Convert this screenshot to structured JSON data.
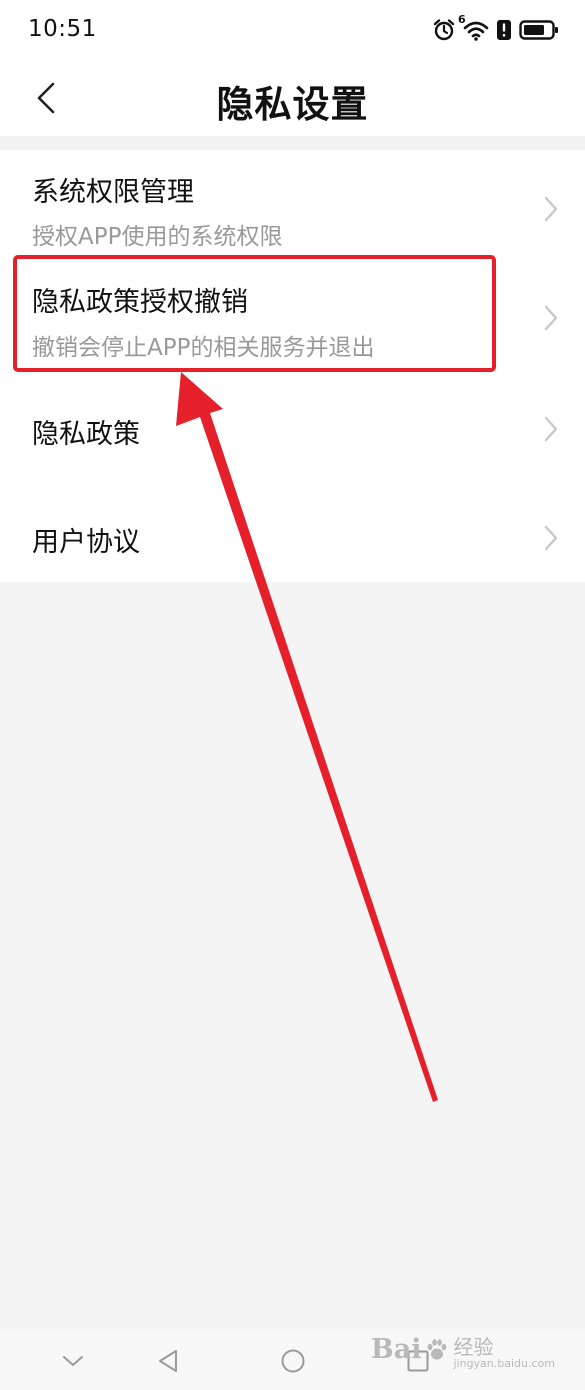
{
  "status_bar": {
    "time": "10:51",
    "icons": [
      "alarm-icon",
      "wifi-icon",
      "alert-icon",
      "battery-icon"
    ],
    "wifi_superscript": "6"
  },
  "header": {
    "back_icon": "chevron-left-icon",
    "title": "隐私设置"
  },
  "settings_list": [
    {
      "title": "系统权限管理",
      "subtitle": "授权APP使用的系统权限"
    },
    {
      "title": "隐私政策授权撤销",
      "subtitle": "撤销会停止APP的相关服务并退出"
    },
    {
      "title": "隐私政策"
    },
    {
      "title": "用户协议"
    }
  ],
  "annotation": {
    "highlighted_item": "隐私政策授权撤销",
    "color": "#e5202b"
  },
  "nav_bar": {
    "buttons": [
      "collapse-icon",
      "back-triangle-icon",
      "home-circle-icon",
      "recents-square-icon"
    ]
  },
  "watermark": {
    "brand": "Bai",
    "brand_suffix": "经验",
    "url": "jingyan.baidu.com"
  }
}
